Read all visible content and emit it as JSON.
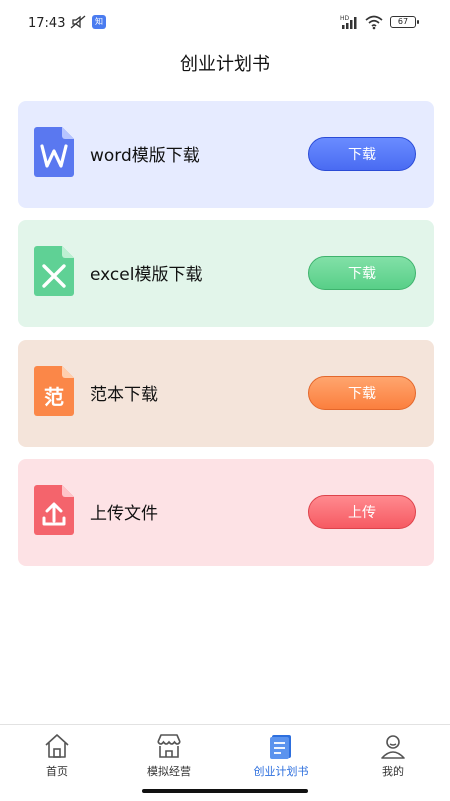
{
  "status_bar": {
    "time": "17:43",
    "app_badge": "知",
    "battery": "67"
  },
  "header": {
    "title": "创业计划书"
  },
  "cards": [
    {
      "label": "word模版下载",
      "button": "下载",
      "icon": "word-document-icon",
      "color": "#4a6bf2"
    },
    {
      "label": "excel模版下载",
      "button": "下载",
      "icon": "excel-document-icon",
      "color": "#58cf88"
    },
    {
      "label": "范本下载",
      "button": "下载",
      "icon": "sample-document-icon",
      "color": "#fb7f3e",
      "icon_text": "范"
    },
    {
      "label": "上传文件",
      "button": "上传",
      "icon": "upload-document-icon",
      "color": "#f65a62"
    }
  ],
  "bottom_nav": {
    "items": [
      {
        "label": "首页",
        "icon": "home-icon",
        "active": false
      },
      {
        "label": "模拟经营",
        "icon": "store-icon",
        "active": false
      },
      {
        "label": "创业计划书",
        "icon": "document-icon",
        "active": true
      },
      {
        "label": "我的",
        "icon": "user-icon",
        "active": false
      }
    ],
    "active_color": "#2d6fde"
  }
}
